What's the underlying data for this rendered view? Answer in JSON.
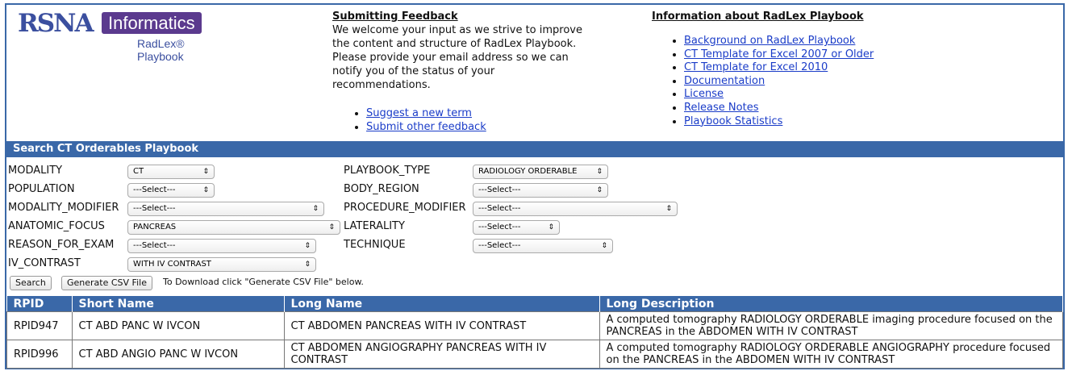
{
  "logo": {
    "main": "RSNA",
    "badge": "Informatics",
    "sub": "RadLex® Playbook"
  },
  "feedback": {
    "title": "Submitting Feedback",
    "lines": [
      "We welcome your input as we strive to improve",
      "the content and structure of RadLex Playbook.",
      "Please provide your email address so we can",
      "notify you of the status of your",
      "recommendations."
    ],
    "links": [
      "Suggest a new term",
      "Submit other feedback"
    ]
  },
  "info": {
    "title": "Information about RadLex Playbook",
    "links": [
      "Background on RadLex Playbook",
      "CT Template for Excel 2007 or Older",
      "CT Template for Excel 2010",
      "Documentation",
      "License",
      "Release Notes",
      "Playbook Statistics"
    ]
  },
  "search": {
    "header": "Search CT Orderables Playbook",
    "fields": {
      "modality": {
        "label": "MODALITY",
        "value": "CT"
      },
      "population": {
        "label": "POPULATION",
        "value": "---Select---"
      },
      "modality_modifier": {
        "label": "MODALITY_MODIFIER",
        "value": "---Select---"
      },
      "anatomic_focus": {
        "label": "ANATOMIC_FOCUS",
        "value": "PANCREAS"
      },
      "reason_for_exam": {
        "label": "REASON_FOR_EXAM",
        "value": "---Select---"
      },
      "iv_contrast": {
        "label": "IV_CONTRAST",
        "value": "WITH IV CONTRAST"
      },
      "playbook_type": {
        "label": "PLAYBOOK_TYPE",
        "value": "RADIOLOGY ORDERABLE"
      },
      "body_region": {
        "label": "BODY_REGION",
        "value": "---Select---"
      },
      "procedure_modifier": {
        "label": "PROCEDURE_MODIFIER",
        "value": "---Select---"
      },
      "laterality": {
        "label": "LATERALITY",
        "value": "---Select---"
      },
      "technique": {
        "label": "TECHNIQUE",
        "value": "---Select---"
      }
    },
    "search_button": "Search",
    "csv_button": "Generate CSV File",
    "note": "To Download click \"Generate CSV File\" below."
  },
  "results": {
    "headers": [
      "RPID",
      "Short Name",
      "Long Name",
      "Long Description"
    ],
    "rows": [
      [
        "RPID947",
        "CT ABD PANC W IVCON",
        "CT ABDOMEN PANCREAS WITH IV CONTRAST",
        "A computed tomography RADIOLOGY ORDERABLE imaging procedure focused on the PANCREAS in the ABDOMEN WITH IV CONTRAST"
      ],
      [
        "RPID996",
        "CT ABD ANGIO PANC W IVCON",
        "CT ABDOMEN ANGIOGRAPHY PANCREAS WITH IV CONTRAST",
        "A computed tomography RADIOLOGY ORDERABLE ANGIOGRAPHY procedure focused on the PANCREAS in the ABDOMEN WITH IV CONTRAST"
      ]
    ]
  },
  "colors": {
    "accent": "#3a68a8",
    "link": "#1a3cc8",
    "logo_badge": "#5b3a8e"
  }
}
